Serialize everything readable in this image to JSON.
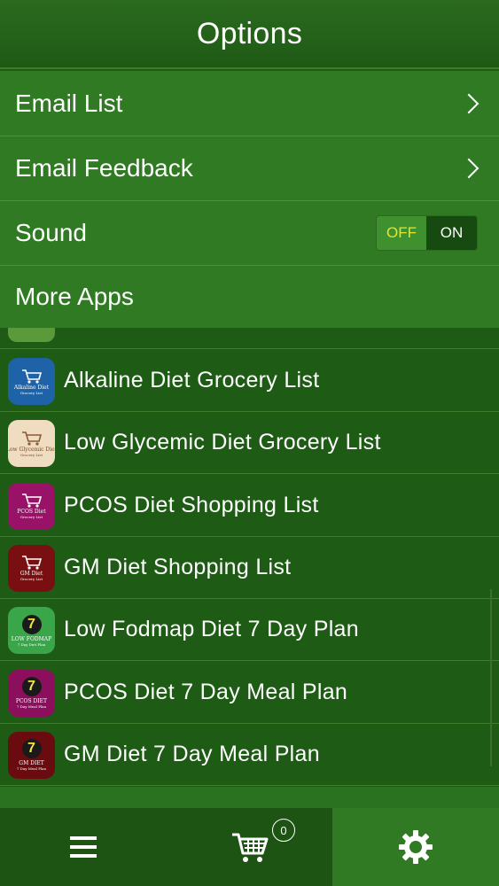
{
  "header": {
    "title": "Options"
  },
  "options": {
    "email_list": "Email List",
    "email_feedback": "Email Feedback",
    "sound": {
      "label": "Sound",
      "off": "OFF",
      "on": "ON",
      "state": "OFF"
    },
    "more_apps": "More Apps"
  },
  "apps": [
    {
      "label": "Alkaline Diet Grocery List",
      "icon_name": "alkaline-cart-icon",
      "icon_text": "Alkaline Diet",
      "icon_sub": "Grocery List",
      "color": "#1e63a8"
    },
    {
      "label": "Low Glycemic Diet Grocery List",
      "icon_name": "low-glycemic-cart-icon",
      "icon_text": "Low Glycemic Diet",
      "icon_sub": "Grocery List",
      "color": "#f0dcc0"
    },
    {
      "label": "PCOS Diet Shopping List",
      "icon_name": "pcos-cart-icon",
      "icon_text": "PCOS Diet",
      "icon_sub": "Grocery List",
      "color": "#9a1268"
    },
    {
      "label": "GM Diet Shopping List",
      "icon_name": "gm-cart-icon",
      "icon_text": "GM Diet",
      "icon_sub": "Grocery List",
      "color": "#7a0f12"
    },
    {
      "label": "Low Fodmap Diet 7 Day Plan",
      "icon_name": "low-fodmap-seven-icon",
      "icon_text": "LOW FODMAP",
      "icon_sub": "7 Day Diet Plan",
      "color": "#3aa64a",
      "seven": "7"
    },
    {
      "label": "PCOS Diet 7 Day Meal Plan",
      "icon_name": "pcos-seven-icon",
      "icon_text": "PCOS DIET",
      "icon_sub": "7 Day Meal Plan",
      "color": "#8c0f5e",
      "seven": "7"
    },
    {
      "label": "GM Diet 7 Day Meal Plan",
      "icon_name": "gm-seven-icon",
      "icon_text": "GM DIET",
      "icon_sub": "7 Day Meal Plan",
      "color": "#6a0b10",
      "seven": "7"
    }
  ],
  "tabbar": {
    "cart_count": "0",
    "active": "settings"
  },
  "colors": {
    "header": "#1f5a15",
    "menu": "#2f7a22",
    "list": "#1e5c15",
    "toggle_off_text": "#e6e32a"
  }
}
